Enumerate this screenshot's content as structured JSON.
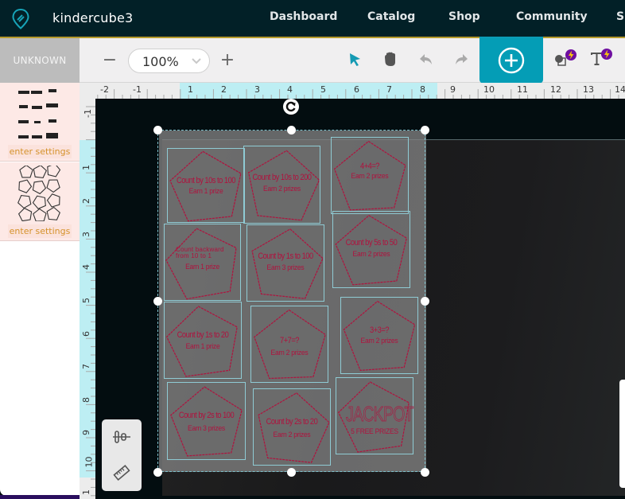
{
  "nav": {
    "brand": "kindercube3",
    "items": [
      "Dashboard",
      "Catalog",
      "Shop",
      "Community",
      "Su"
    ],
    "active_index": 4,
    "colors": {
      "bg": "#022027",
      "accent_gold": "#b59a2c",
      "accent_teal": "#0c9cb6"
    }
  },
  "toolbar": {
    "mode_tab": "UNKNOWN",
    "zoom_minus": "−",
    "zoom_value": "100%",
    "zoom_plus": "+",
    "tools": [
      "select-arrow",
      "hand-pan",
      "undo",
      "redo",
      "add",
      "shapes-premium",
      "text-premium"
    ],
    "add_color": "#049db6"
  },
  "layers": [
    {
      "name": "text labels layer",
      "settings_label": "enter settings"
    },
    {
      "name": "pentagons layer",
      "settings_label": "enter settings"
    }
  ],
  "ruler": {
    "horizontal": [
      "-2",
      "-1",
      "1",
      "2",
      "3",
      "4",
      "5",
      "6",
      "7",
      "8",
      "9",
      "10",
      "11",
      "12",
      "13",
      "14"
    ],
    "vertical": [
      "-1",
      "1",
      "2",
      "3",
      "4",
      "5",
      "6",
      "7",
      "8",
      "9",
      "10",
      "1"
    ]
  },
  "tiles": [
    {
      "line1": "Count by 10s to 100",
      "line2": "Earn 1 prize"
    },
    {
      "line1": "Count by 10s to 200",
      "line2": "Earn 2 prizes"
    },
    {
      "line1": "4+4=?",
      "line2": "Earn 2 prizes"
    },
    {
      "line1a": "Count backward",
      "line1b": "from 10 to 1",
      "line2": "Earn 1 prize"
    },
    {
      "line1": "Count by 1s to 100",
      "line2": "Earn 3 prizes"
    },
    {
      "line1": "Count by 5s to 50",
      "line2": "Earn 2 prizes"
    },
    {
      "line1": "Count by 1s to 20",
      "line2": "Earn 1 prize"
    },
    {
      "line1": "7+7=?",
      "line2": "Earn 2 prizes"
    },
    {
      "line1": "3+3=?",
      "line2": "Earn 2 prizes"
    },
    {
      "line1": "Count by 2s to 100",
      "line2": "Earn 3 prizes"
    },
    {
      "line1": "Count by 2s to 20",
      "line2": "Earn 2 prizes"
    },
    {
      "line1": "JACKPOT",
      "line2": "5 FREE PRIZES"
    }
  ]
}
